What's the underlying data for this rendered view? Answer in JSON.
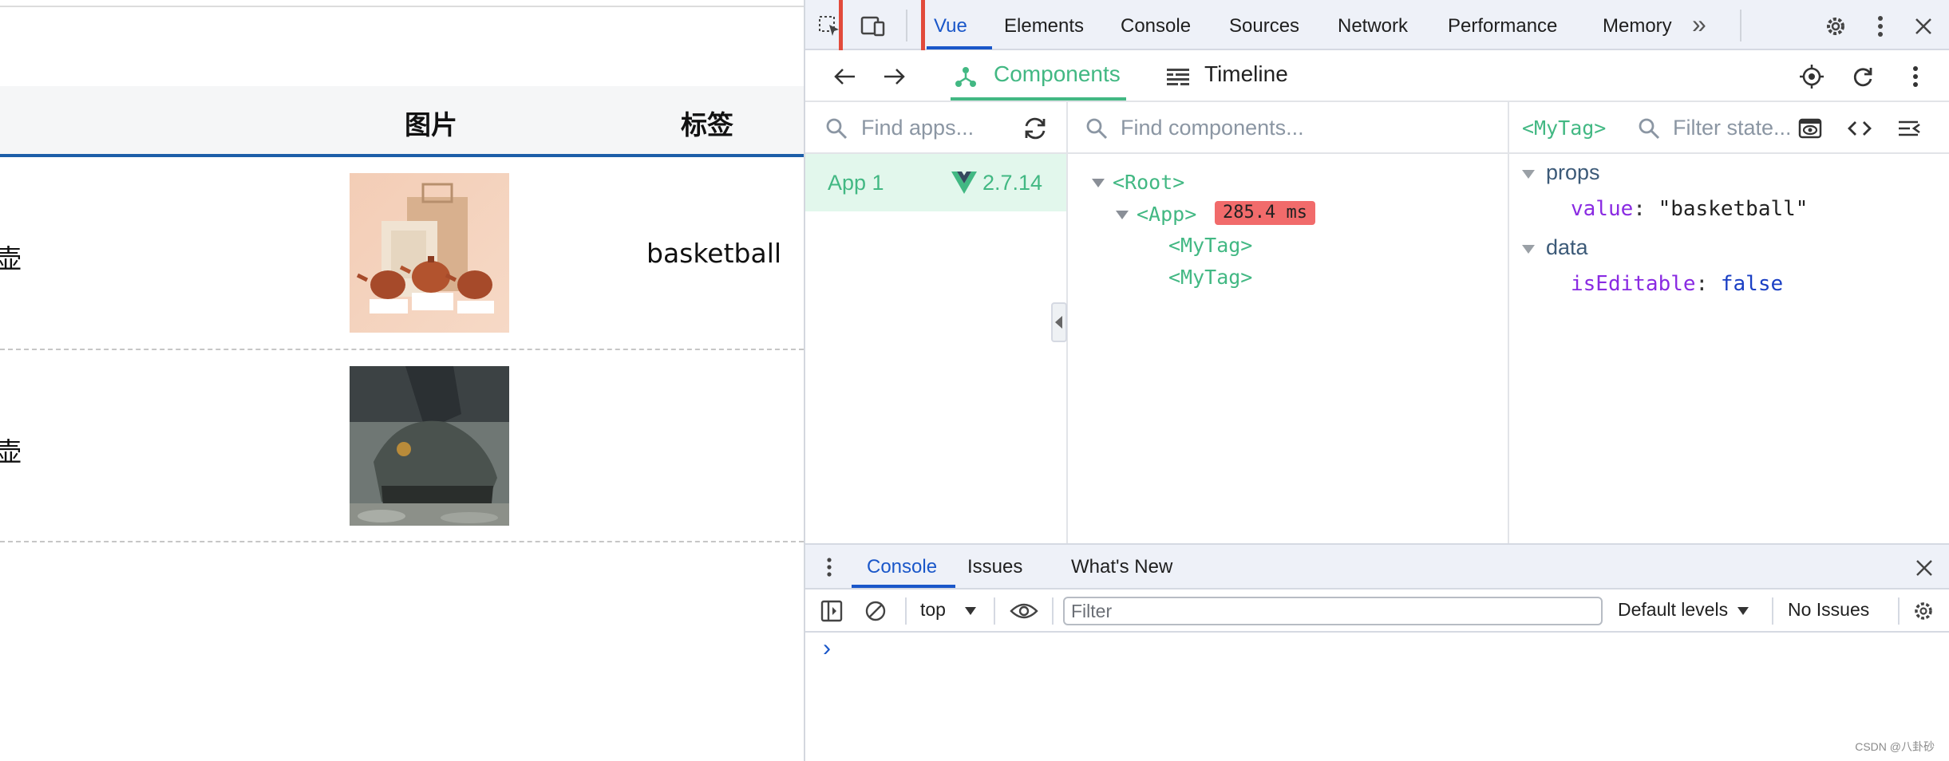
{
  "table": {
    "headers": {
      "image": "图片",
      "tag": "标签"
    },
    "rows": [
      {
        "name_fragment": "壶",
        "tag": "basketball"
      },
      {
        "name_fragment": "壶",
        "tag": ""
      }
    ]
  },
  "devtools": {
    "tabs": [
      "Vue",
      "Elements",
      "Console",
      "Sources",
      "Network",
      "Performance",
      "Memory"
    ],
    "more_tabs": "»",
    "vue": {
      "sub_tabs": {
        "components": "Components",
        "timeline": "Timeline"
      },
      "apps": {
        "search_placeholder": "Find apps...",
        "items": [
          {
            "name": "App 1",
            "version": "2.7.14"
          }
        ]
      },
      "tree": {
        "search_placeholder": "Find components...",
        "nodes": {
          "root": "<Root>",
          "app": "<App>",
          "app_badge": "285.4 ms",
          "child1": "<MyTag>",
          "child2": "<MyTag>"
        }
      },
      "state": {
        "selected_component": "<MyTag>",
        "filter_placeholder": "Filter state...",
        "props_label": "props",
        "prop_key": "value",
        "prop_value": "\"basketball\"",
        "data_label": "data",
        "data_key": "isEditable",
        "data_value": "false"
      }
    },
    "drawer": {
      "tabs": {
        "console": "Console",
        "issues": "Issues",
        "whats_new": "What's New"
      },
      "context": "top",
      "filter_placeholder": "Filter",
      "levels": "Default levels",
      "issues_status": "No Issues",
      "prompt": "›"
    }
  },
  "watermark": "CSDN @八卦砂",
  "colors": {
    "vue_green": "#42b883",
    "active_blue": "#1a57c9",
    "badge_red": "#f16b6b",
    "highlight": "#e24a3b"
  }
}
